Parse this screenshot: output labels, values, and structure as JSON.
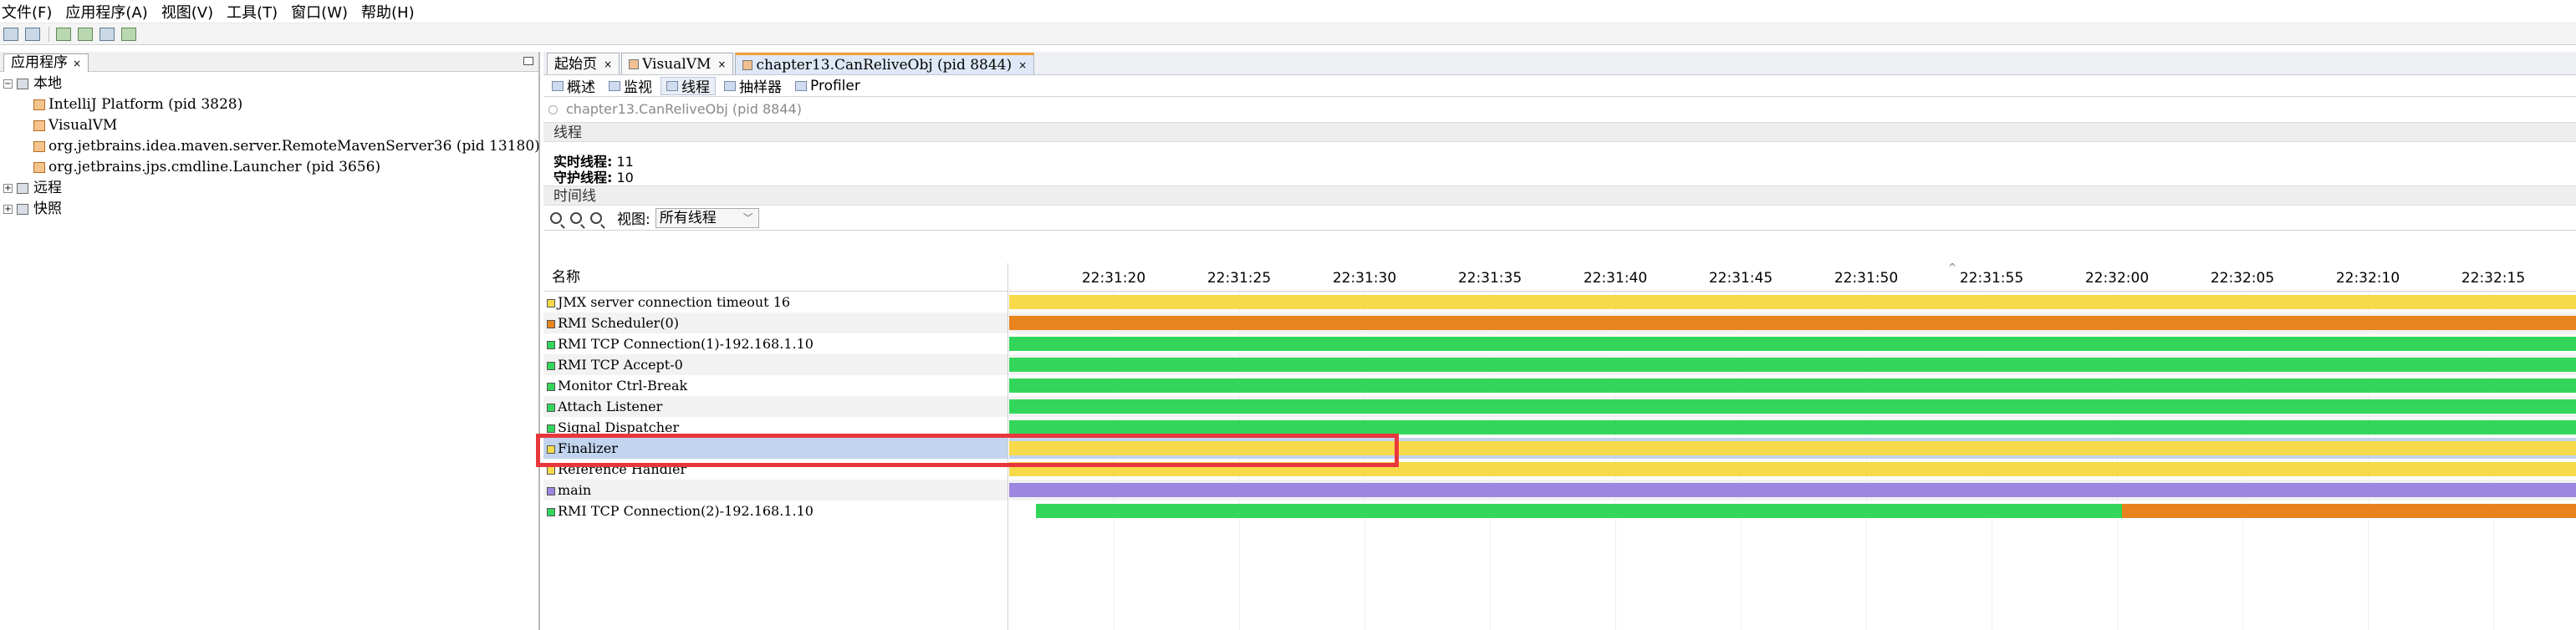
{
  "menu": [
    "文件(F)",
    "应用程序(A)",
    "视图(V)",
    "工具(T)",
    "窗口(W)",
    "帮助(H)"
  ],
  "left_panel": {
    "tab_label": "应用程序",
    "tree": [
      {
        "label": "本地",
        "level": 0,
        "expander": "−"
      },
      {
        "label": "IntelliJ Platform (pid 3828)",
        "level": 2,
        "icon": "java-app-icon"
      },
      {
        "label": "VisualVM",
        "level": 2,
        "icon": "visualvm-icon"
      },
      {
        "label": "org.jetbrains.idea.maven.server.RemoteMavenServer36 (pid 13180)",
        "level": 2,
        "icon": "java-process-icon"
      },
      {
        "label": "org.jetbrains.jps.cmdline.Launcher (pid 3656)",
        "level": 2,
        "icon": "java-process-icon"
      },
      {
        "label": "远程",
        "level": 0,
        "expander": ""
      },
      {
        "label": "快照",
        "level": 0,
        "expander": ""
      }
    ]
  },
  "doc_tabs": [
    {
      "label": "起始页",
      "active": false
    },
    {
      "label": "VisualVM",
      "active": false
    },
    {
      "label": "chapter13.CanReliveObj (pid 8844)",
      "active": true
    }
  ],
  "sub_tabs": [
    {
      "label": "概述",
      "active": false
    },
    {
      "label": "监视",
      "active": false
    },
    {
      "label": "线程",
      "active": true
    },
    {
      "label": "抽样器",
      "active": false
    },
    {
      "label": "Profiler",
      "active": false
    }
  ],
  "process_name": "chapter13.CanReliveObj (pid 8844)",
  "threads_section": {
    "header": "线程",
    "live_label": "实时线程:",
    "live_value": "11",
    "daemon_label": "守护线程:",
    "daemon_value": "10"
  },
  "timeline": {
    "header": "时间线",
    "view_label": "视图:",
    "view_value": "所有线程",
    "name_col_header": "名称",
    "ticks": [
      "22:31:20",
      "22:31:25",
      "22:31:30",
      "22:31:35",
      "22:31:40",
      "22:31:45",
      "22:31:50",
      "22:31:55",
      "22:32:00",
      "22:32:05",
      "22:32:10",
      "22:32:15"
    ]
  },
  "colors": {
    "running": "#33d65a",
    "sleeping": "#f7da4a",
    "wait": "#e8831d",
    "park": "#9c86e0",
    "highlight": "#e8373c"
  },
  "threads": [
    {
      "name": "JMX server connection timeout 16",
      "state": "sleeping",
      "segments": [
        {
          "start": 0,
          "end": 1,
          "state": "sleeping"
        }
      ]
    },
    {
      "name": "RMI Scheduler(0)",
      "state": "wait",
      "segments": [
        {
          "start": 0,
          "end": 1,
          "state": "wait"
        }
      ]
    },
    {
      "name": "RMI TCP Connection(1)-192.168.1.10",
      "state": "running",
      "segments": [
        {
          "start": 0,
          "end": 1,
          "state": "running"
        }
      ]
    },
    {
      "name": "RMI TCP Accept-0",
      "state": "running",
      "segments": [
        {
          "start": 0,
          "end": 1,
          "state": "running"
        }
      ]
    },
    {
      "name": "Monitor Ctrl-Break",
      "state": "running",
      "segments": [
        {
          "start": 0,
          "end": 1,
          "state": "running"
        }
      ]
    },
    {
      "name": "Attach Listener",
      "state": "running",
      "segments": [
        {
          "start": 0,
          "end": 1,
          "state": "running"
        }
      ]
    },
    {
      "name": "Signal Dispatcher",
      "state": "running",
      "segments": [
        {
          "start": 0,
          "end": 1,
          "state": "running"
        }
      ]
    },
    {
      "name": "Finalizer",
      "state": "sleeping",
      "segments": [
        {
          "start": 0,
          "end": 1,
          "state": "sleeping"
        }
      ]
    },
    {
      "name": "Reference Handler",
      "state": "sleeping",
      "segments": [
        {
          "start": 0,
          "end": 1,
          "state": "sleeping"
        }
      ]
    },
    {
      "name": "main",
      "state": "park",
      "segments": [
        {
          "start": 0,
          "end": 1,
          "state": "park"
        }
      ]
    },
    {
      "name": "RMI TCP Connection(2)-192.168.1.10",
      "state": "running",
      "segments": [
        {
          "start": 0.017,
          "end": 0.71,
          "state": "running"
        },
        {
          "start": 0.71,
          "end": 1,
          "state": "wait"
        }
      ]
    }
  ],
  "selected_thread": "Finalizer"
}
